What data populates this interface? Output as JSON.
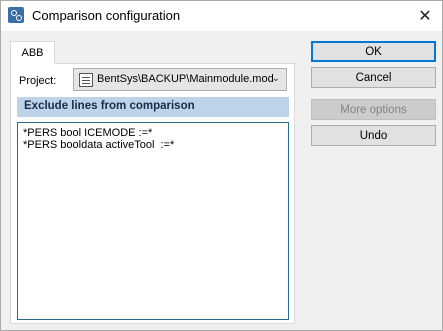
{
  "window": {
    "title": "Comparison configuration",
    "icon": "app-icon",
    "close_glyph": "✕"
  },
  "tabs": [
    {
      "label": "ABB",
      "active": true
    }
  ],
  "panel": {
    "project_label": "Project:",
    "project_value": "BentSys\\BACKUP\\Mainmodule.mod",
    "section_header": "Exclude lines from comparison",
    "exclude_lines": "*PERS bool ICEMODE :=*\n*PERS booldata activeTool  :=*"
  },
  "buttons": {
    "ok": "OK",
    "cancel": "Cancel",
    "more_options": "More options",
    "undo": "Undo"
  },
  "colors": {
    "section_header_bg": "#bcd3ea",
    "default_button_border": "#0078d7"
  }
}
